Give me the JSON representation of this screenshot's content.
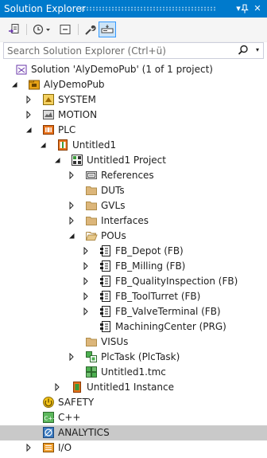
{
  "panel": {
    "title": "Solution Explorer",
    "pin_glyph": "▾",
    "close_glyph": "✕"
  },
  "search": {
    "placeholder": "Search Solution Explorer (Ctrl+ü)"
  },
  "tree": [
    {
      "label": "Solution 'AlyDemoPub' (1 of 1 project)",
      "icon": "solution-icon",
      "indent": 0,
      "expander": "none"
    },
    {
      "label": "AlyDemoPub",
      "icon": "twincat-project-icon",
      "indent": 1,
      "expander": "expanded"
    },
    {
      "label": "SYSTEM",
      "icon": "system-icon",
      "indent": 2,
      "expander": "collapsed"
    },
    {
      "label": "MOTION",
      "icon": "motion-icon",
      "indent": 2,
      "expander": "collapsed"
    },
    {
      "label": "PLC",
      "icon": "plc-icon",
      "indent": 2,
      "expander": "expanded"
    },
    {
      "label": "Untitled1",
      "icon": "plc-project-icon",
      "indent": 3,
      "expander": "expanded"
    },
    {
      "label": "Untitled1 Project",
      "icon": "plc-subproject-icon",
      "indent": 4,
      "expander": "expanded"
    },
    {
      "label": "References",
      "icon": "references-icon",
      "indent": 5,
      "expander": "collapsed"
    },
    {
      "label": "DUTs",
      "icon": "folder-icon",
      "indent": 5,
      "expander": "none"
    },
    {
      "label": "GVLs",
      "icon": "folder-icon",
      "indent": 5,
      "expander": "collapsed"
    },
    {
      "label": "Interfaces",
      "icon": "folder-icon",
      "indent": 5,
      "expander": "collapsed"
    },
    {
      "label": "POUs",
      "icon": "folder-open-icon",
      "indent": 5,
      "expander": "expanded"
    },
    {
      "label": "FB_Depot (FB)",
      "icon": "function-block-icon",
      "indent": 6,
      "expander": "collapsed"
    },
    {
      "label": "FB_Milling (FB)",
      "icon": "function-block-icon",
      "indent": 6,
      "expander": "collapsed"
    },
    {
      "label": "FB_QualityInspection (FB)",
      "icon": "function-block-icon",
      "indent": 6,
      "expander": "collapsed"
    },
    {
      "label": "FB_ToolTurret (FB)",
      "icon": "function-block-icon",
      "indent": 6,
      "expander": "collapsed"
    },
    {
      "label": "FB_ValveTerminal (FB)",
      "icon": "function-block-icon",
      "indent": 6,
      "expander": "collapsed"
    },
    {
      "label": "MachiningCenter (PRG)",
      "icon": "program-icon",
      "indent": 6,
      "expander": "none"
    },
    {
      "label": "VISUs",
      "icon": "folder-icon",
      "indent": 5,
      "expander": "none"
    },
    {
      "label": "PlcTask (PlcTask)",
      "icon": "plc-task-icon",
      "indent": 5,
      "expander": "collapsed"
    },
    {
      "label": "Untitled1.tmc",
      "icon": "tmc-file-icon",
      "indent": 5,
      "expander": "none"
    },
    {
      "label": "Untitled1 Instance",
      "icon": "plc-instance-icon",
      "indent": 4,
      "expander": "collapsed"
    },
    {
      "label": "SAFETY",
      "icon": "safety-icon",
      "indent": 2,
      "expander": "none"
    },
    {
      "label": "C++",
      "icon": "cpp-icon",
      "indent": 2,
      "expander": "none"
    },
    {
      "label": "ANALYTICS",
      "icon": "analytics-icon",
      "indent": 2,
      "expander": "none",
      "selected": true
    },
    {
      "label": "I/O",
      "icon": "io-icon",
      "indent": 2,
      "expander": "collapsed"
    }
  ],
  "colors": {
    "title_bar": "#007acc",
    "selection": "#c9c9c9",
    "folder": "#dcb67a"
  }
}
